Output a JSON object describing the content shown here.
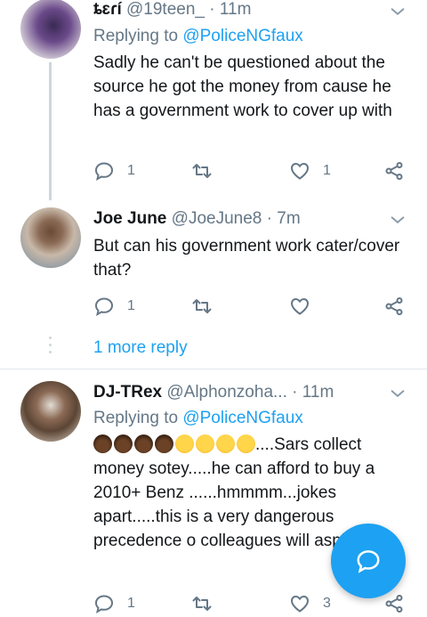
{
  "tweets": [
    {
      "name": "ȶɛɾí",
      "handle": "@19teen_",
      "time": "11m",
      "replying_prefix": "Replying to ",
      "replying_to": "@PoliceNGfaux",
      "text": "Sadly he can't be questioned about the source he got the money from cause he has a government work to cover up with",
      "replies": "1",
      "retweets": "",
      "likes": "1"
    },
    {
      "name": "Joe June",
      "handle": "@JoeJune8",
      "time": "7m",
      "text": "But can his government work cater/cover that?",
      "replies": "1",
      "retweets": "",
      "likes": ""
    },
    {
      "name": "DJ-TRex",
      "handle": "@Alphonzoha...",
      "time": "11m",
      "replying_prefix": "Replying to ",
      "replying_to": "@PoliceNGfaux",
      "text_after_emoji": "....Sars collect money sotey.....he can afford to buy a 2010+ Benz ......hmmmm...jokes apart.....this is a very dangerous precedence o colleagues will aspire",
      "emoji": [
        "facepalm-dark",
        "facepalm-dark",
        "facepalm-dark",
        "facepalm-dark",
        "joy",
        "rofl",
        "joy",
        "sweat-smile"
      ],
      "replies": "1",
      "retweets": "",
      "likes": "3"
    }
  ],
  "more_reply": "1 more reply",
  "colors": {
    "accent": "#1da1f2",
    "muted": "#657786",
    "line": "#ccd6dd"
  },
  "icons": [
    "reply-icon",
    "retweet-icon",
    "like-icon",
    "share-icon",
    "chevron-down-icon",
    "compose-reply-icon"
  ]
}
